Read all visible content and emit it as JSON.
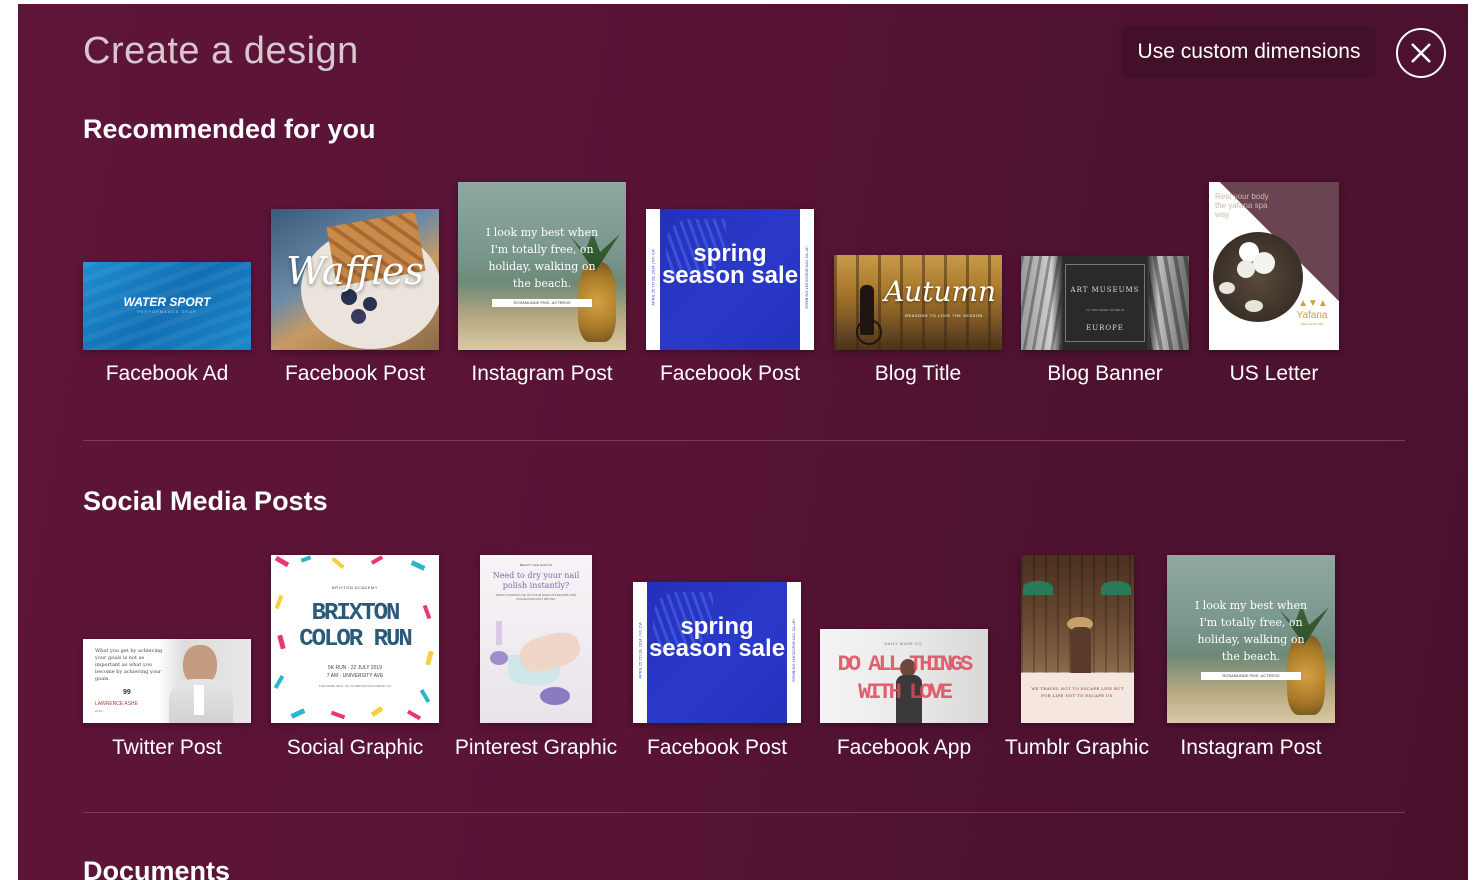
{
  "header": {
    "title": "Create a design",
    "custom_button": "Use custom dimensions"
  },
  "sections": {
    "recommended": {
      "title": "Recommended for you",
      "items": [
        {
          "label": "Facebook Ad",
          "thumb_text": "WATER SPORT",
          "thumb_sub": "PERFORMANCE GEAR"
        },
        {
          "label": "Facebook Post",
          "thumb_text": "Waffles"
        },
        {
          "label": "Instagram Post",
          "thumb_text": "I look my best when I'm totally free, on holiday, walking on the beach.",
          "thumb_sub": "ROSAMUNDE PIKE, ACTRESS"
        },
        {
          "label": "Facebook Post",
          "thumb_text": "spring season sale",
          "thumb_side_left": "APRIL 25 TO 28, 2014 | NY, CA",
          "thumb_side_right": "UP TO 70% DISCOUNT ON BAGS"
        },
        {
          "label": "Blog Title",
          "thumb_text": "Autumn",
          "thumb_sub": "REASONS TO LOVE THE SEASON"
        },
        {
          "label": "Blog Banner",
          "thumb_text": "ART MUSEUMS",
          "thumb_mid": "TO VISIT WHEN YOU'RE IN",
          "thumb_sub": "EUROPE"
        },
        {
          "label": "US Letter",
          "thumb_text": "Rest your body the yafana spa way",
          "thumb_sub": "Yafana",
          "thumb_caption": "WELLNESS SPA"
        }
      ]
    },
    "social": {
      "title": "Social Media Posts",
      "items": [
        {
          "label": "Twitter Post",
          "thumb_text": "What you get by achieving your goals is not as important as what you become by achieving your goals.",
          "thumb_sub": "LAWRENCE ASHE",
          "thumb_caption": "Writer"
        },
        {
          "label": "Social Graphic",
          "thumb_top": "BRIXTON ACADEMY",
          "thumb_text": "BRIXTON COLOR RUN",
          "thumb_sub": "5K RUN · 22 JULY 2019",
          "thumb_mid": "7 AM · UNIVERSITY AVE",
          "thumb_caption": "FOR MORE INFO, GO TO BRIXTONCOLORRUN.CO"
        },
        {
          "label": "Pinterest Graphic",
          "thumb_top": "BEAUTY LIFE HACK #1",
          "thumb_text": "Need to dry your nail polish instantly?",
          "thumb_sub": "SPRAY COOKING OIL ON YOUR NAILS AFTER APPLYING POLISH FOR FAST DRYING"
        },
        {
          "label": "Facebook Post",
          "thumb_text": "spring season sale",
          "thumb_side_left": "APRIL 25 TO 28, 2014 | NY, CA",
          "thumb_side_right": "UP TO 70% DISCOUNT ON BAGS"
        },
        {
          "label": "Facebook App",
          "thumb_top": "DAILY MUSE CO.",
          "thumb_text": "DO ALL THINGS WITH LOVE"
        },
        {
          "label": "Tumblr Graphic",
          "thumb_text": "WE TRAVEL NOT TO ESCAPE LIFE BUT FOR LIFE NOT TO ESCAPE US."
        },
        {
          "label": "Instagram Post",
          "thumb_text": "I look my best when I'm totally free, on holiday, walking on the beach.",
          "thumb_sub": "ROSAMUNDE PIKE, ACTRESS"
        }
      ]
    },
    "documents": {
      "title": "Documents"
    }
  },
  "colors": {
    "background": "#581335",
    "button_bg": "#421028",
    "text": "#ffffff",
    "spring_blue": "#2b39c9"
  },
  "icons": {
    "close": "close-icon"
  }
}
